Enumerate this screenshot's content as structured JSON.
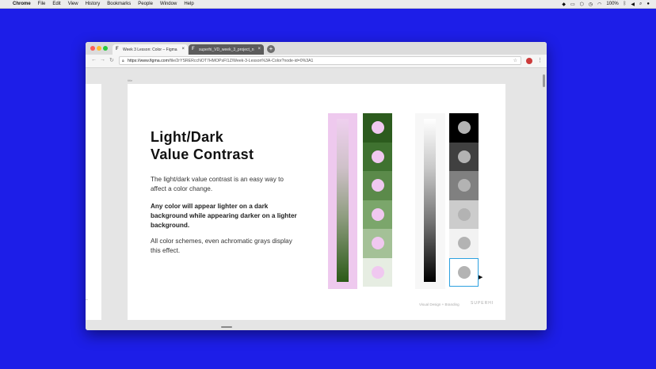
{
  "menubar": {
    "app_name": "Chrome",
    "items": [
      "File",
      "Edit",
      "View",
      "History",
      "Bookmarks",
      "People",
      "Window",
      "Help"
    ],
    "battery": "100%",
    "right_icons": [
      "dropbox-icon",
      "screen-icon",
      "shield-icon",
      "clock-icon",
      "wifi-icon",
      "bluetooth-icon",
      "volume-icon",
      "search-icon",
      "user-icon"
    ]
  },
  "browser": {
    "tabs": [
      {
        "label": "Week 3 Lesson: Color – Figma",
        "active": true
      },
      {
        "label": "superhi_VD_week_3_project_n",
        "active": false
      }
    ],
    "new_tab": "+",
    "url_host": "https://www.figma.com",
    "url_path": "/file/2rYSRERccNOT7HMOPsFI1Z/Week-3-Lesson%3A-Color?node-id=0%3A1"
  },
  "canvas": {
    "frame_label": "title",
    "slide": {
      "title_line1": "Light/Dark",
      "title_line2": "Value Contrast",
      "paragraph1": "The light/dark value contrast is an easy way to affect a color change.",
      "paragraph2": "Any color will appear lighter on a dark background while appearing darker on a lighter background.",
      "paragraph3": "All color schemes, even achromatic grays display this effect.",
      "footer_text": "Visual Design + Branding",
      "footer_logo": "SUPERHI"
    },
    "swatches": {
      "green_backgrounds": [
        "#2c5b1e",
        "#3f7230",
        "#5b8a4a",
        "#7ba66b",
        "#a4c197",
        "#e6ede2"
      ],
      "green_dot": "#f0c8f0",
      "gray_backgrounds": [
        "#000000",
        "#404040",
        "#808080",
        "#cccccc",
        "#f2f2f2",
        "#ffffff"
      ],
      "gray_dot": "#b3b3b3",
      "selected_index": 5
    }
  },
  "colors": {
    "desktop": "#1d1ee8",
    "selection": "#2da1e0"
  }
}
